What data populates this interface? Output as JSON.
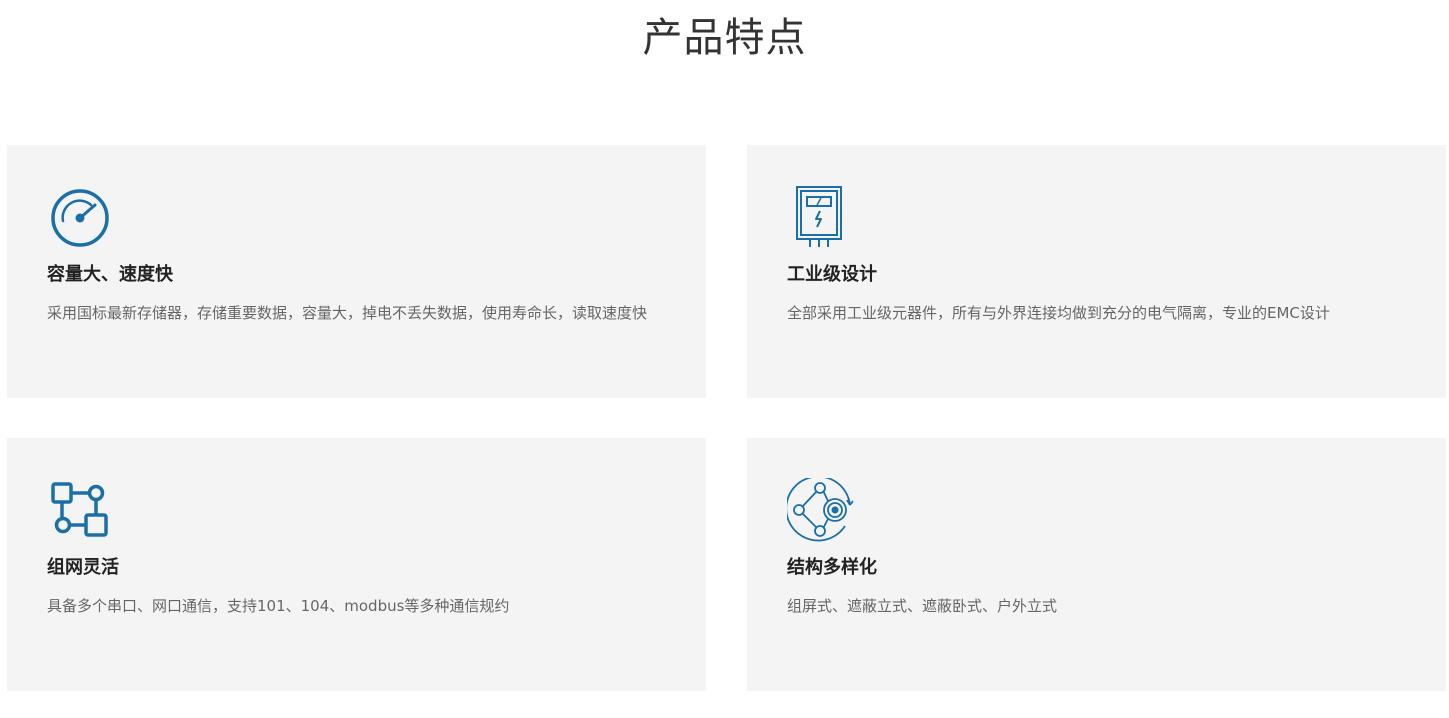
{
  "page": {
    "title": "产品特点"
  },
  "colors": {
    "accent": "#1a6fa8",
    "card_bg": "#f4f4f4",
    "title_text": "#333333",
    "desc_text": "#666666"
  },
  "features": [
    {
      "icon": "speedometer-icon",
      "title": "容量大、速度快",
      "description": "采用国标最新存储器，存储重要数据，容量大，掉电不丢失数据，使用寿命长，读取速度快"
    },
    {
      "icon": "electric-cabinet-icon",
      "title": "工业级设计",
      "description": "全部采用工业级元器件，所有与外界连接均做到充分的电气隔离，专业的EMC设计"
    },
    {
      "icon": "network-nodes-icon",
      "title": "组网灵活",
      "description": "具备多个串口、网口通信，支持101、104、modbus等多种通信规约"
    },
    {
      "icon": "structure-hub-icon",
      "title": "结构多样化",
      "description": "组屏式、遮蔽立式、遮蔽卧式、户外立式"
    }
  ]
}
